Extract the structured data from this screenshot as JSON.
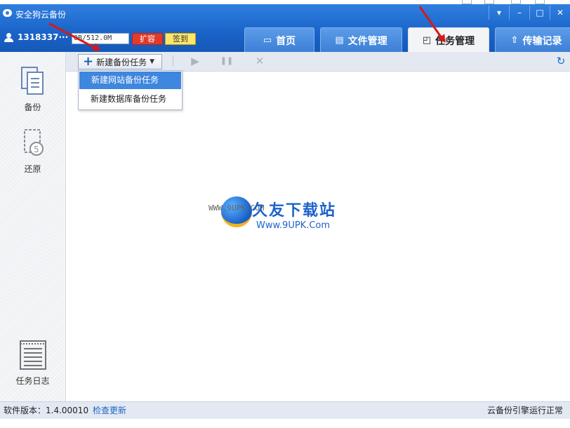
{
  "window": {
    "title": "安全狗云备份",
    "controls": [
      "▾",
      "–",
      "□",
      "✕"
    ]
  },
  "user": {
    "name": "1318337···",
    "quota_text": "0B/512.0M",
    "quota_used_fraction": 0.0,
    "expand_label": "扩容",
    "signin_label": "签到"
  },
  "tabs": [
    {
      "label": "首页",
      "icon": "drive-icon",
      "glyph": "▭",
      "active": false
    },
    {
      "label": "文件管理",
      "icon": "file-manage-icon",
      "glyph": "▤",
      "active": false
    },
    {
      "label": "任务管理",
      "icon": "task-monitor-icon",
      "glyph": "◰",
      "active": true
    },
    {
      "label": "传输记录",
      "icon": "upload-icon",
      "glyph": "⇧",
      "active": false
    }
  ],
  "sidebar": {
    "items": [
      {
        "label": "备份",
        "icon": "backup-document-icon"
      },
      {
        "label": "还原",
        "icon": "restore-icon"
      },
      {
        "label": "任务日志",
        "icon": "task-log-icon"
      }
    ]
  },
  "toolbar": {
    "new_task_label": "新建备份任务",
    "play_glyph": "▶",
    "pause_glyph": "❚❚",
    "stop_glyph": "✕",
    "refresh_glyph": "↻"
  },
  "dropdown": {
    "items": [
      "新建网站备份任务",
      "新建数据库备份任务"
    ],
    "highlighted_index": 0
  },
  "watermark": {
    "small": "WWW.9UPK.COM",
    "title": "久友下载站",
    "url": "Www.9UPK.Com"
  },
  "statusbar": {
    "version": "软件版本：1.4.00010",
    "check_update": "检查更新",
    "engine_status": "云备份引擎运行正常"
  },
  "colors": {
    "header": "#1a63c8",
    "accent": "#3f86df",
    "expand": "#e23a2a",
    "signin": "#ffe66b",
    "arrow": "#d41a1a"
  }
}
